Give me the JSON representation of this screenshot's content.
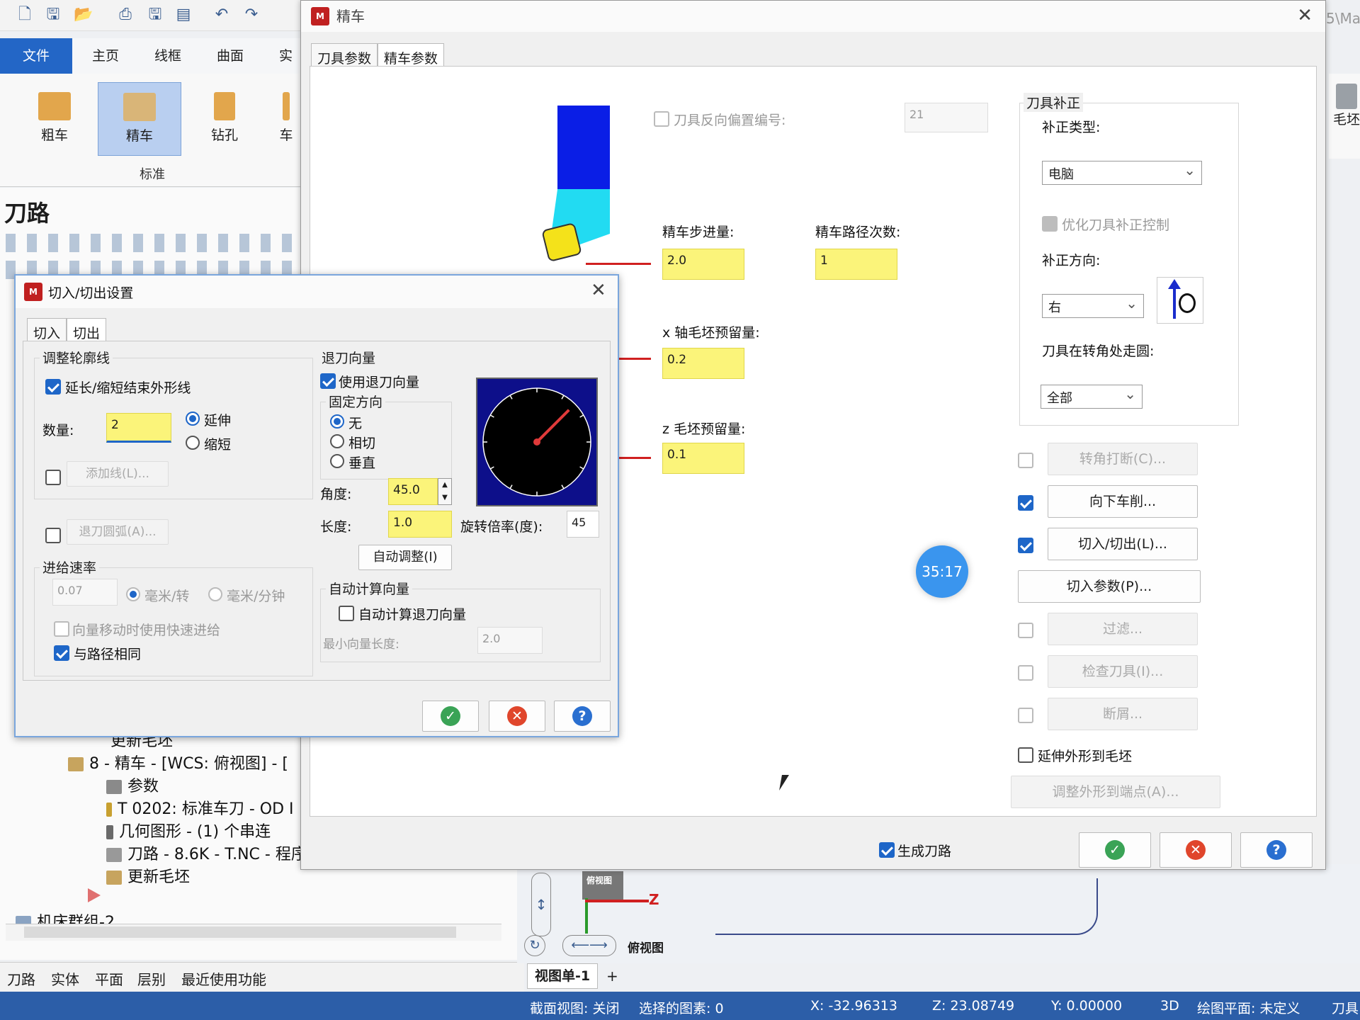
{
  "ribbon": {
    "tabs": [
      "文件",
      "主页",
      "线框",
      "曲面",
      "实体"
    ],
    "buttons": [
      "粗车",
      "精车",
      "钻孔",
      "车"
    ],
    "group_label": "标准",
    "right_partial": "毛坯"
  },
  "toolpath_panel": {
    "title": "刀路",
    "tree": [
      "更新毛坯",
      "8 - 精车 - [WCS: 俯视图] - [",
      "参数",
      "T 0202: 标准车刀 - OD I",
      "几何图形 - (1) 个串连",
      "刀路 - 8.6K - T.NC - 程序",
      "更新毛坯",
      "机床群组-2"
    ],
    "bottom_tabs": [
      "刀路",
      "实体",
      "平面",
      "层别",
      "最近使用功能"
    ]
  },
  "viewport": {
    "tab": "视图单-1",
    "add_tab": "+",
    "view_label": "俯视图",
    "axis_label": "Z",
    "path_partial": "5\\Ma"
  },
  "status": {
    "section_view": "截面视图: 关闭",
    "selected": "选择的图素: 0",
    "x": "X:  -32.96313",
    "z": "Z:  23.08749",
    "y": "Y:  0.00000",
    "mode": "3D",
    "plane": "绘图平面: 未定义",
    "toolplane": "刀具"
  },
  "main_dialog": {
    "title": "精车",
    "tabs": [
      "刀具参数",
      "精车参数"
    ],
    "reverse_offset_label": "刀具反向偏置编号:",
    "reverse_offset_value": "21",
    "step_label": "精车步进量:",
    "step_value": "2.0",
    "passes_label": "精车路径次数:",
    "passes_value": "1",
    "x_stock_label": "x 轴毛坯预留量:",
    "x_stock_value": "0.2",
    "z_stock_label": "z 毛坯预留量:",
    "z_stock_value": "0.1",
    "comp_group": "刀具补正",
    "comp_type_label": "补正类型:",
    "comp_type_value": "电脑",
    "optimize_label": "优化刀具补正控制",
    "comp_dir_label": "补正方向:",
    "comp_dir_value": "右",
    "corner_label": "刀具在转角处走圆:",
    "corner_value": "全部",
    "buttons": {
      "corner_break": "转角打断(C)...",
      "plunge": "向下车削...",
      "leadinout": "切入/切出(L)...",
      "plunge_params": "切入参数(P)...",
      "filter": "过滤...",
      "check_tool": "检查刀具(I)...",
      "chip_break": "断屑...",
      "extend_stock": "延伸外形到毛坯",
      "adjust_endpoint": "调整外形到端点(A)..."
    },
    "generate_label": "生成刀路"
  },
  "sub_dialog": {
    "title": "切入/切出设置",
    "tabs": [
      "切入",
      "切出"
    ],
    "adjust_group": "调整轮廓线",
    "extend_check": "延长/缩短结束外形线",
    "amount_label": "数量:",
    "amount_value": "2",
    "extend_radio": "延伸",
    "shorten_radio": "缩短",
    "add_line": "添加线(L)...",
    "retract_arc": "退刀圆弧(A)...",
    "feed_group": "进给速率",
    "feed_value": "0.07",
    "mm_rev": "毫米/转",
    "mm_min": "毫米/分钟",
    "rapid_check": "向量移动时使用快速进给",
    "same_path": "与路径相同",
    "retract_group": "退刀向量",
    "use_retract": "使用退刀向量",
    "fixed_dir": "固定方向",
    "dir_none": "无",
    "dir_tangent": "相切",
    "dir_perp": "垂直",
    "angle_label": "角度:",
    "angle_value": "45.0",
    "length_label": "长度:",
    "length_value": "1.0",
    "rotation_label": "旋转倍率(度):",
    "rotation_value": "45",
    "auto_adjust": "自动调整(I)",
    "auto_calc_group": "自动计算向量",
    "auto_calc_check": "自动计算退刀向量",
    "min_len_label": "最小向量长度:",
    "min_len_value": "2.0",
    "dial_angle_deg": 45
  },
  "timer": "35:17",
  "colors": {
    "accent": "#1e66c8",
    "highlight_input": "#fbf47a",
    "status_bar": "#2c5ea8"
  }
}
